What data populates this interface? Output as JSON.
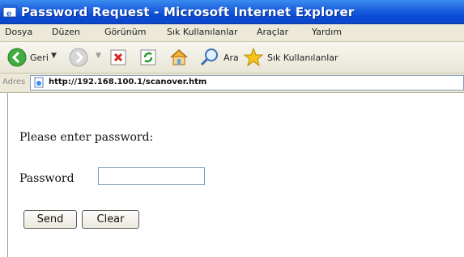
{
  "window": {
    "title": "Password Request - Microsoft Internet Explorer"
  },
  "menu": {
    "items": [
      "Dosya",
      "Düzen",
      "Görünüm",
      "Sık Kullanılanlar",
      "Araçlar",
      "Yardım"
    ]
  },
  "toolbar": {
    "back_label": "Geri",
    "search_label": "Ara",
    "favorites_label": "Sık Kullanılanlar",
    "icons": [
      "back-icon",
      "forward-icon",
      "stop-icon",
      "refresh-icon",
      "home-icon",
      "search-icon",
      "favorites-icon"
    ]
  },
  "address": {
    "label": "Adres",
    "url": "http://192.168.100.1/scanover.htm"
  },
  "page": {
    "prompt": "Please enter password:",
    "password_label": "Password",
    "password_value": "",
    "send_label": "Send",
    "clear_label": "Clear"
  },
  "colors": {
    "titlebar": "#0a4bd6",
    "chrome": "#ece9d8"
  }
}
